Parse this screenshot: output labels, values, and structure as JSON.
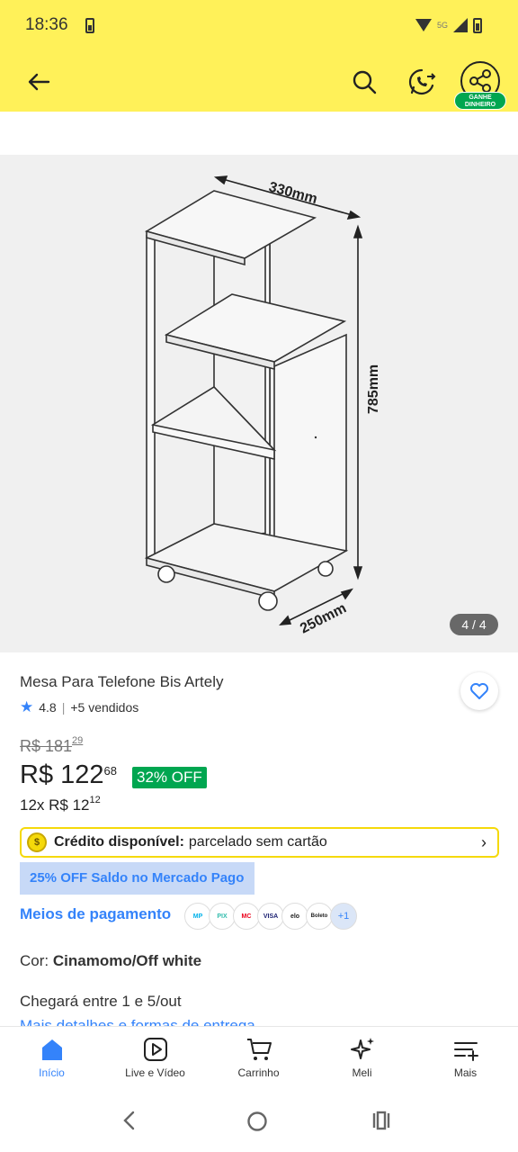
{
  "status": {
    "time": "18:36",
    "network": "5G"
  },
  "appbar": {
    "earn_label": "GANHE DINHEIRO"
  },
  "gallery": {
    "counter": "4 / 4",
    "dim_width": "330mm",
    "dim_height": "785mm",
    "dim_depth": "250mm"
  },
  "product": {
    "title": "Mesa Para Telefone Bis Artely",
    "rating": "4.8",
    "sold": "+5 vendidos",
    "old_price_main": "R$ 181",
    "old_price_cents": "29",
    "price_main": "R$ 122",
    "price_cents": "68",
    "discount": "32% OFF",
    "installment_main": "12x R$ 12",
    "installment_cents": "12"
  },
  "credit": {
    "bold": "Crédito disponível:",
    "text": "parcelado sem cartão",
    "coin": "$"
  },
  "promo": "25% OFF Saldo no Mercado Pago",
  "payment": {
    "label": "Meios de pagamento",
    "icons": [
      "MP",
      "PIX",
      "MC",
      "VISA",
      "elo",
      "Boleto"
    ],
    "more": "+1"
  },
  "color": {
    "label": "Cor:",
    "value": "Cinamomo/Off white"
  },
  "delivery": {
    "text": "Chegará entre 1 e 5/out",
    "link": "Mais detalhes e formas de entrega"
  },
  "navbar": {
    "items": [
      {
        "label": "Início"
      },
      {
        "label": "Live e Vídeo"
      },
      {
        "label": "Carrinho"
      },
      {
        "label": "Meli"
      },
      {
        "label": "Mais"
      }
    ]
  },
  "colors": {
    "yellow": "#fff159",
    "blue": "#3483fa",
    "green": "#00a650"
  }
}
